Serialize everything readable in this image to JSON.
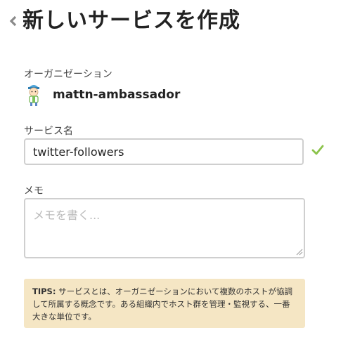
{
  "header": {
    "title": "新しいサービスを作成",
    "back_icon": "chevron-left-icon"
  },
  "organization": {
    "label": "オーガニゼーション",
    "name": "mattn-ambassador",
    "avatar_icon": "avatar"
  },
  "service_name": {
    "label": "サービス名",
    "value": "twitter-followers",
    "valid_icon": "check-icon",
    "valid_color": "#8bc34a"
  },
  "memo": {
    "label": "メモ",
    "placeholder": "メモを書く...",
    "value": ""
  },
  "tips": {
    "label": "TIPS:",
    "text": " サービスとは、オーガニゼーションにおいて複数のホストが協調して所属する概念です。ある組織内でホスト群を管理・監視する、一番大きな単位です。",
    "background": "#f5e6c4"
  }
}
